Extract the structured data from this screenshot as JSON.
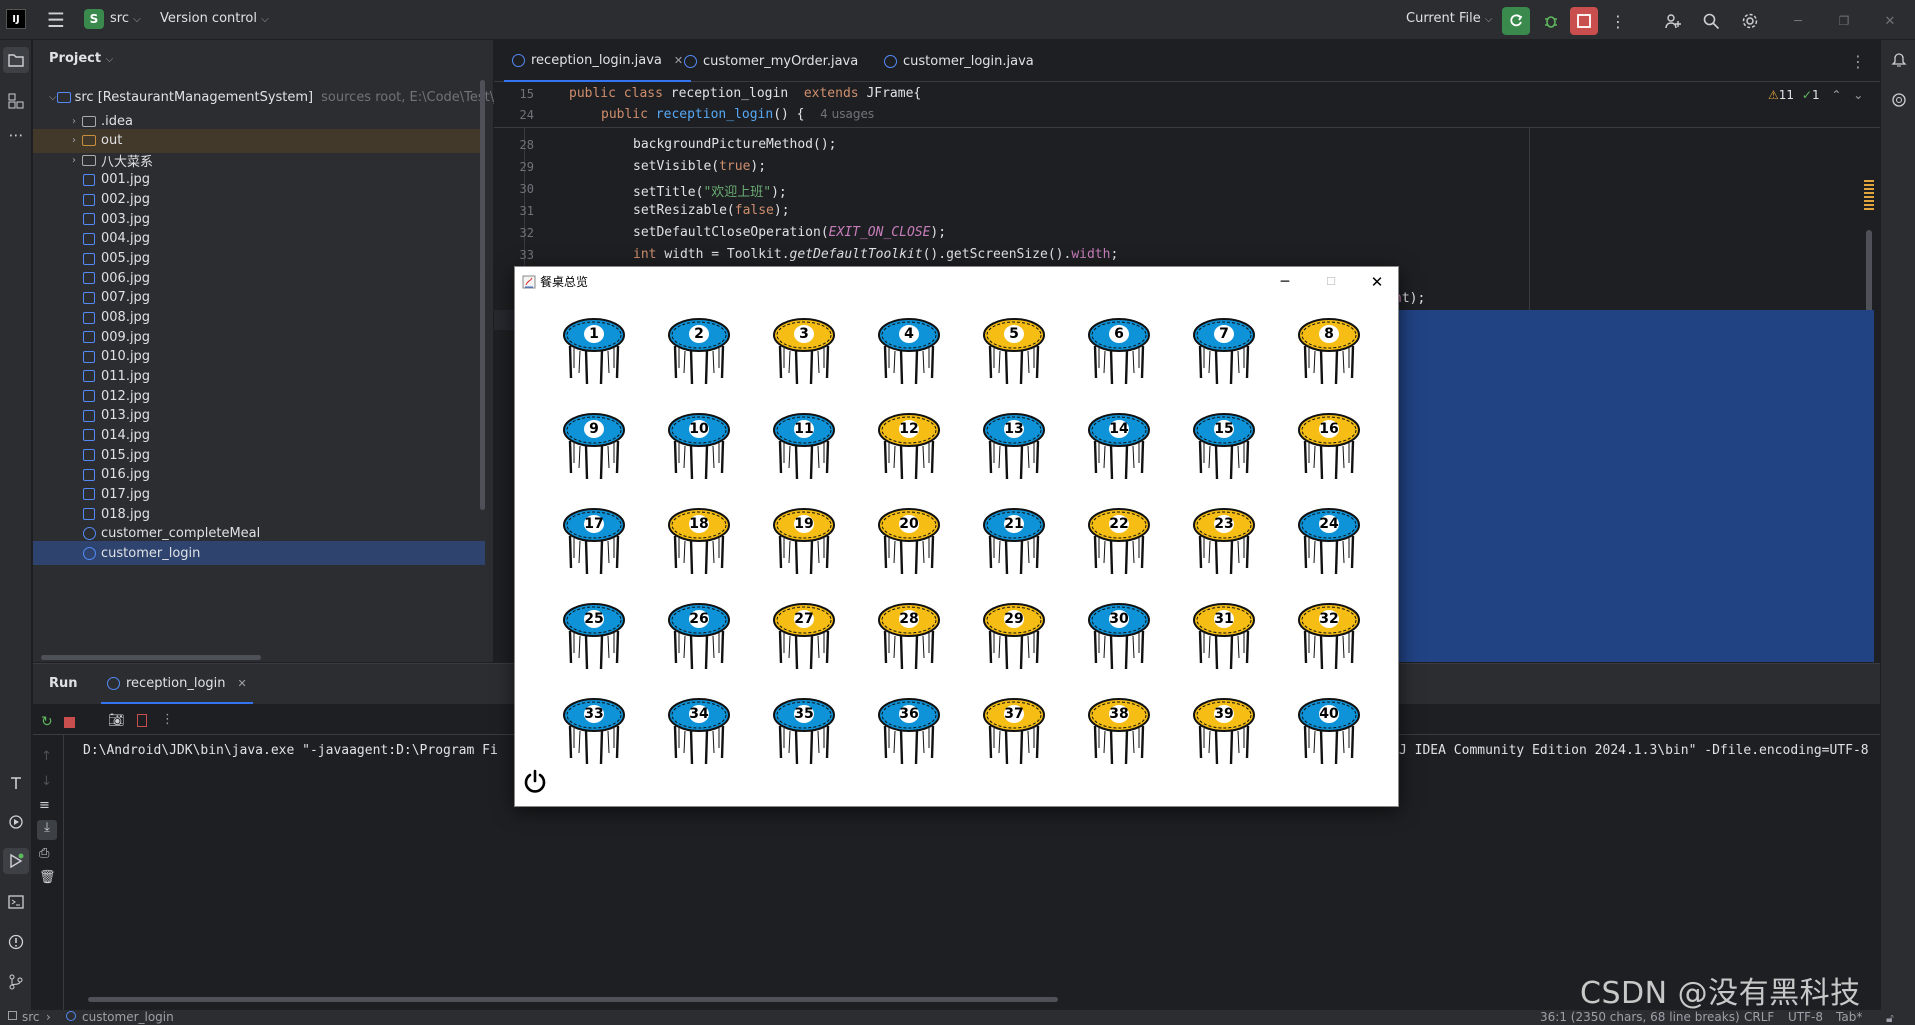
{
  "titlebar": {
    "logo": "IJ",
    "project_badge": "S",
    "project_name": "src",
    "vcs_label": "Version control",
    "run_config": "Current File",
    "icons": [
      "hamburger-icon",
      "run-icon",
      "debug-icon",
      "stop-icon",
      "more-icon",
      "add-user-icon",
      "search-icon",
      "settings-icon",
      "minimize-icon",
      "restore-icon",
      "close-icon"
    ]
  },
  "project": {
    "header": "Project",
    "root_label": "src [RestaurantManagementSystem]",
    "root_note": "sources root, E:\\Code\\Test\\Ja",
    "items": [
      {
        "label": ".idea",
        "type": "folder"
      },
      {
        "label": "out",
        "type": "folder-orange"
      },
      {
        "label": "八大菜系",
        "type": "folder"
      },
      {
        "label": "001.jpg",
        "type": "image"
      },
      {
        "label": "002.jpg",
        "type": "image"
      },
      {
        "label": "003.jpg",
        "type": "image"
      },
      {
        "label": "004.jpg",
        "type": "image"
      },
      {
        "label": "005.jpg",
        "type": "image"
      },
      {
        "label": "006.jpg",
        "type": "image"
      },
      {
        "label": "007.jpg",
        "type": "image"
      },
      {
        "label": "008.jpg",
        "type": "image"
      },
      {
        "label": "009.jpg",
        "type": "image"
      },
      {
        "label": "010.jpg",
        "type": "image"
      },
      {
        "label": "011.jpg",
        "type": "image"
      },
      {
        "label": "012.jpg",
        "type": "image"
      },
      {
        "label": "013.jpg",
        "type": "image"
      },
      {
        "label": "014.jpg",
        "type": "image"
      },
      {
        "label": "015.jpg",
        "type": "image"
      },
      {
        "label": "016.jpg",
        "type": "image"
      },
      {
        "label": "017.jpg",
        "type": "image"
      },
      {
        "label": "018.jpg",
        "type": "image"
      },
      {
        "label": "customer_completeMeal",
        "type": "class"
      },
      {
        "label": "customer_login",
        "type": "class"
      }
    ]
  },
  "editor": {
    "tabs": [
      "reception_login.java",
      "customer_myOrder.java",
      "customer_login.java"
    ],
    "warnings": "11",
    "checks": "1",
    "sticky": [
      {
        "ln": "15",
        "code": "public class reception_login  extends JFrame{"
      },
      {
        "ln": "24",
        "code": "public reception_login() {",
        "hint": "4 usages"
      }
    ],
    "lines": [
      {
        "ln": "28",
        "code": "backgroundPictureMethod();"
      },
      {
        "ln": "29",
        "code": "setVisible(true);"
      },
      {
        "ln": "30",
        "code": "setTitle(\"欢迎上班\");"
      },
      {
        "ln": "31",
        "code": "setResizable(false);"
      },
      {
        "ln": "32",
        "code": "setDefaultCloseOperation(EXIT_ON_CLOSE);"
      },
      {
        "ln": "33",
        "code": "int width = Toolkit.getDefaultToolkit().getScreenSize().width;"
      }
    ],
    "tail_fragment": "ht);"
  },
  "run": {
    "label": "Run",
    "tab": "reception_login",
    "console_left": "D:\\Android\\JDK\\bin\\java.exe \"-javaagent:D:\\Program Fi",
    "console_right": "J IDEA Community Edition 2024.1.3\\bin\" -Dfile.encoding=UTF-8"
  },
  "java_window": {
    "title": "餐桌总览",
    "colors": {
      "blue": "#0f93d8",
      "yellow": "#f6be14"
    },
    "tables": [
      {
        "n": "1",
        "c": "blue"
      },
      {
        "n": "2",
        "c": "blue"
      },
      {
        "n": "3",
        "c": "yellow"
      },
      {
        "n": "4",
        "c": "blue"
      },
      {
        "n": "5",
        "c": "yellow"
      },
      {
        "n": "6",
        "c": "blue"
      },
      {
        "n": "7",
        "c": "blue"
      },
      {
        "n": "8",
        "c": "yellow"
      },
      {
        "n": "9",
        "c": "blue"
      },
      {
        "n": "10",
        "c": "blue"
      },
      {
        "n": "11",
        "c": "blue"
      },
      {
        "n": "12",
        "c": "yellow"
      },
      {
        "n": "13",
        "c": "blue"
      },
      {
        "n": "14",
        "c": "blue"
      },
      {
        "n": "15",
        "c": "blue"
      },
      {
        "n": "16",
        "c": "yellow"
      },
      {
        "n": "17",
        "c": "blue"
      },
      {
        "n": "18",
        "c": "yellow"
      },
      {
        "n": "19",
        "c": "yellow"
      },
      {
        "n": "20",
        "c": "yellow"
      },
      {
        "n": "21",
        "c": "blue"
      },
      {
        "n": "22",
        "c": "yellow"
      },
      {
        "n": "23",
        "c": "yellow"
      },
      {
        "n": "24",
        "c": "blue"
      },
      {
        "n": "25",
        "c": "blue"
      },
      {
        "n": "26",
        "c": "blue"
      },
      {
        "n": "27",
        "c": "yellow"
      },
      {
        "n": "28",
        "c": "yellow"
      },
      {
        "n": "29",
        "c": "yellow"
      },
      {
        "n": "30",
        "c": "blue"
      },
      {
        "n": "31",
        "c": "yellow"
      },
      {
        "n": "32",
        "c": "yellow"
      },
      {
        "n": "33",
        "c": "blue"
      },
      {
        "n": "34",
        "c": "blue"
      },
      {
        "n": "35",
        "c": "blue"
      },
      {
        "n": "36",
        "c": "blue"
      },
      {
        "n": "37",
        "c": "yellow"
      },
      {
        "n": "38",
        "c": "yellow"
      },
      {
        "n": "39",
        "c": "yellow"
      },
      {
        "n": "40",
        "c": "blue"
      }
    ]
  },
  "statusbar": {
    "crumb1": "src",
    "crumb2": "customer_login",
    "position": "36:1 (2350 chars, 68 line breaks)",
    "line_sep": "CRLF",
    "encoding": "UTF-8",
    "indent": "Tab*"
  },
  "watermark": "CSDN @没有黑科技"
}
